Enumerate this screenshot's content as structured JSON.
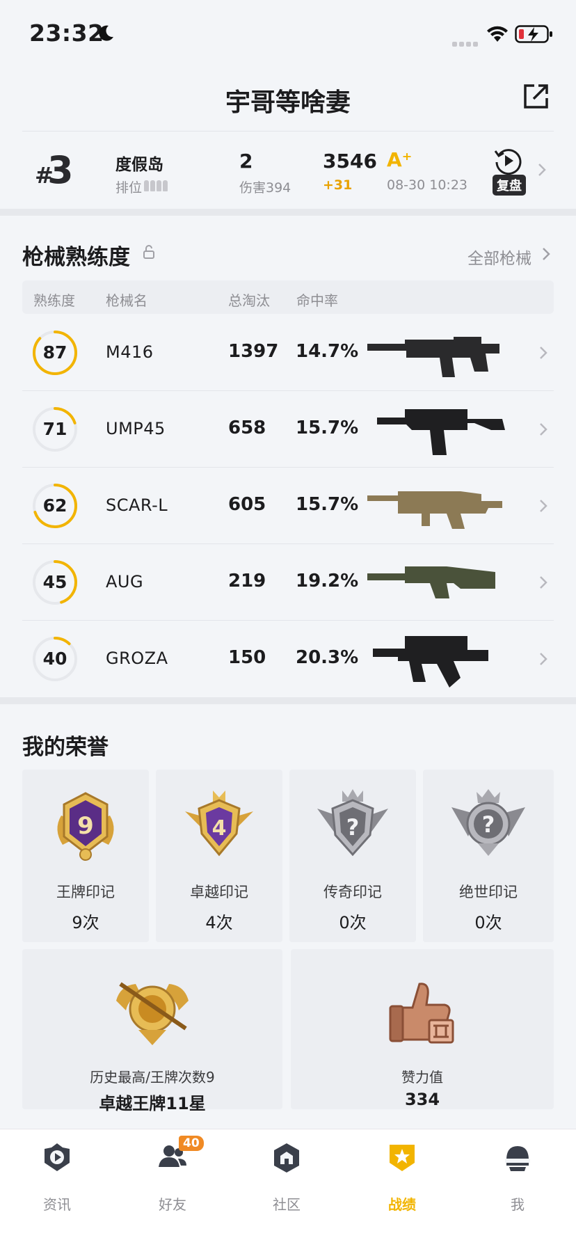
{
  "status_bar": {
    "time": "23:32"
  },
  "header": {
    "title": "宇哥等啥妻"
  },
  "latest_match": {
    "rank_prefix": "#",
    "rank": "3",
    "map": "度假岛",
    "mode_label": "排位",
    "kills": "2",
    "damage_label": "伤害394",
    "score": "3546",
    "score_delta": "+31",
    "grade": "A⁺",
    "time": "08-30 10:23",
    "replay_label": "复盘"
  },
  "weapons_section": {
    "title": "枪械熟练度",
    "all_link": "全部枪械",
    "columns": [
      "熟练度",
      "枪械名",
      "总淘汰",
      "命中率"
    ],
    "rows": [
      {
        "proficiency": "87",
        "level": 0.87,
        "name": "M416",
        "kills": "1397",
        "accuracy": "14.7%"
      },
      {
        "proficiency": "71",
        "level": 0.2,
        "name": "UMP45",
        "kills": "658",
        "accuracy": "15.7%"
      },
      {
        "proficiency": "62",
        "level": 0.7,
        "name": "SCAR-L",
        "kills": "605",
        "accuracy": "15.7%"
      },
      {
        "proficiency": "45",
        "level": 0.45,
        "name": "AUG",
        "kills": "219",
        "accuracy": "19.2%"
      },
      {
        "proficiency": "40",
        "level": 0.12,
        "name": "GROZA",
        "kills": "150",
        "accuracy": "20.3%"
      }
    ]
  },
  "honors_section": {
    "title": "我的荣誉",
    "marks": [
      {
        "name": "王牌印记",
        "count": "9次",
        "emblem": "ace-emblem-icon",
        "emblem_text": "9"
      },
      {
        "name": "卓越印记",
        "count": "4次",
        "emblem": "excellence-emblem-icon",
        "emblem_text": "4"
      },
      {
        "name": "传奇印记",
        "count": "0次",
        "emblem": "legend-emblem-icon",
        "emblem_text": "?"
      },
      {
        "name": "绝世印记",
        "count": "0次",
        "emblem": "peerless-emblem-icon",
        "emblem_text": "?"
      }
    ],
    "highest": {
      "label": "历史最高/王牌次数9",
      "value": "卓越王牌11星"
    },
    "likes": {
      "label": "赞力值",
      "value": "334"
    }
  },
  "bottom_nav": {
    "items": [
      {
        "label": "资讯",
        "icon": "news-icon"
      },
      {
        "label": "好友",
        "icon": "friends-icon",
        "badge": "40"
      },
      {
        "label": "社区",
        "icon": "community-icon"
      },
      {
        "label": "战绩",
        "icon": "record-icon",
        "active": true
      },
      {
        "label": "我",
        "icon": "profile-helmet-icon"
      }
    ]
  },
  "colors": {
    "accent": "#f2b400",
    "ring_track": "#e6e8ec",
    "badge": "#f08a24"
  }
}
